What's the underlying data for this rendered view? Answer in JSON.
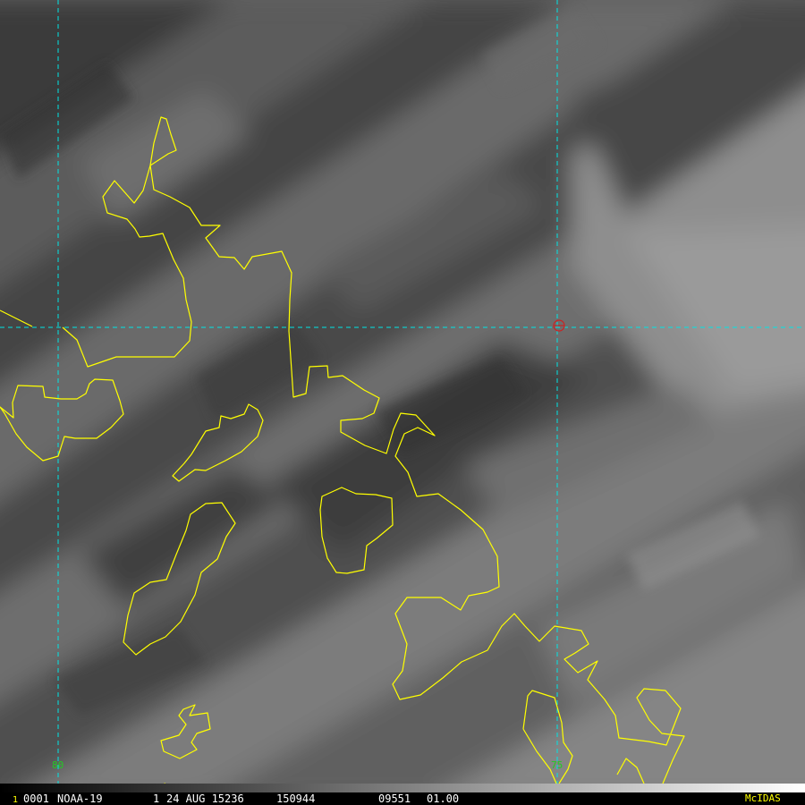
{
  "image": {
    "type": "satellite-water-vapor-imagery",
    "palette": "grayscale",
    "coastline_color": "#ffff00",
    "gridline_color": "#00e5e5",
    "grid_label_color": "#22cc22",
    "center_marker_color": "#cc2222"
  },
  "grid": {
    "longitude_labels": [
      "80",
      "75"
    ],
    "style": "dashed"
  },
  "status_bar": {
    "frame": "1",
    "frame_color": "#ffff00",
    "id": "0001",
    "satellite": "NOAA-19",
    "band": "1",
    "date": "24 AUG 15236",
    "time": "150944",
    "location": "09551",
    "resolution": "01.00",
    "brand": "McIDAS",
    "brand_color": "#ffff00"
  }
}
